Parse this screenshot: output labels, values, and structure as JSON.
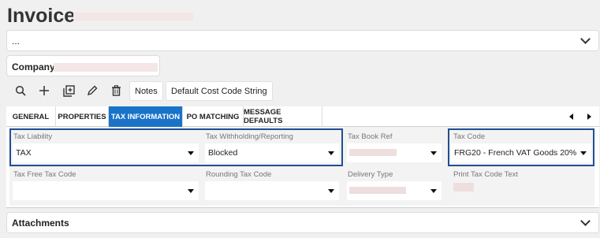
{
  "page": {
    "title": "Invoice"
  },
  "header_panel": {
    "text": "..."
  },
  "company": {
    "label": "Company:"
  },
  "toolbar": {
    "icons": [
      "search-icon",
      "plus-icon",
      "copy-add-icon",
      "pencil-icon",
      "trash-icon"
    ],
    "notes_label": "Notes",
    "default_cost_code_label": "Default Cost Code String"
  },
  "tabs": [
    {
      "label": "GENERAL",
      "active": false
    },
    {
      "label": "PROPERTIES",
      "active": false
    },
    {
      "label": "TAX INFORMATION",
      "active": true
    },
    {
      "label": "PO MATCHING",
      "active": false
    },
    {
      "label": "MESSAGE DEFAULTS",
      "active": false
    }
  ],
  "form": {
    "tax_liability": {
      "label": "Tax Liability",
      "value": "TAX"
    },
    "tax_withholding": {
      "label": "Tax Withholding/Reporting",
      "value": "Blocked"
    },
    "tax_book_ref": {
      "label": "Tax Book Ref",
      "value": ""
    },
    "tax_code": {
      "label": "Tax Code",
      "value": "FRG20 - French VAT Goods 20%"
    },
    "tax_free_tax_code": {
      "label": "Tax Free Tax Code",
      "value": ""
    },
    "rounding_tax_code": {
      "label": "Rounding Tax Code",
      "value": ""
    },
    "delivery_type": {
      "label": "Delivery Type",
      "value": ""
    },
    "print_tax_code_text": {
      "label": "Print Tax Code Text"
    }
  },
  "attachments": {
    "label": "Attachments"
  },
  "colors": {
    "accent": "#1a73c9",
    "highlight_border": "#1f4f91"
  }
}
